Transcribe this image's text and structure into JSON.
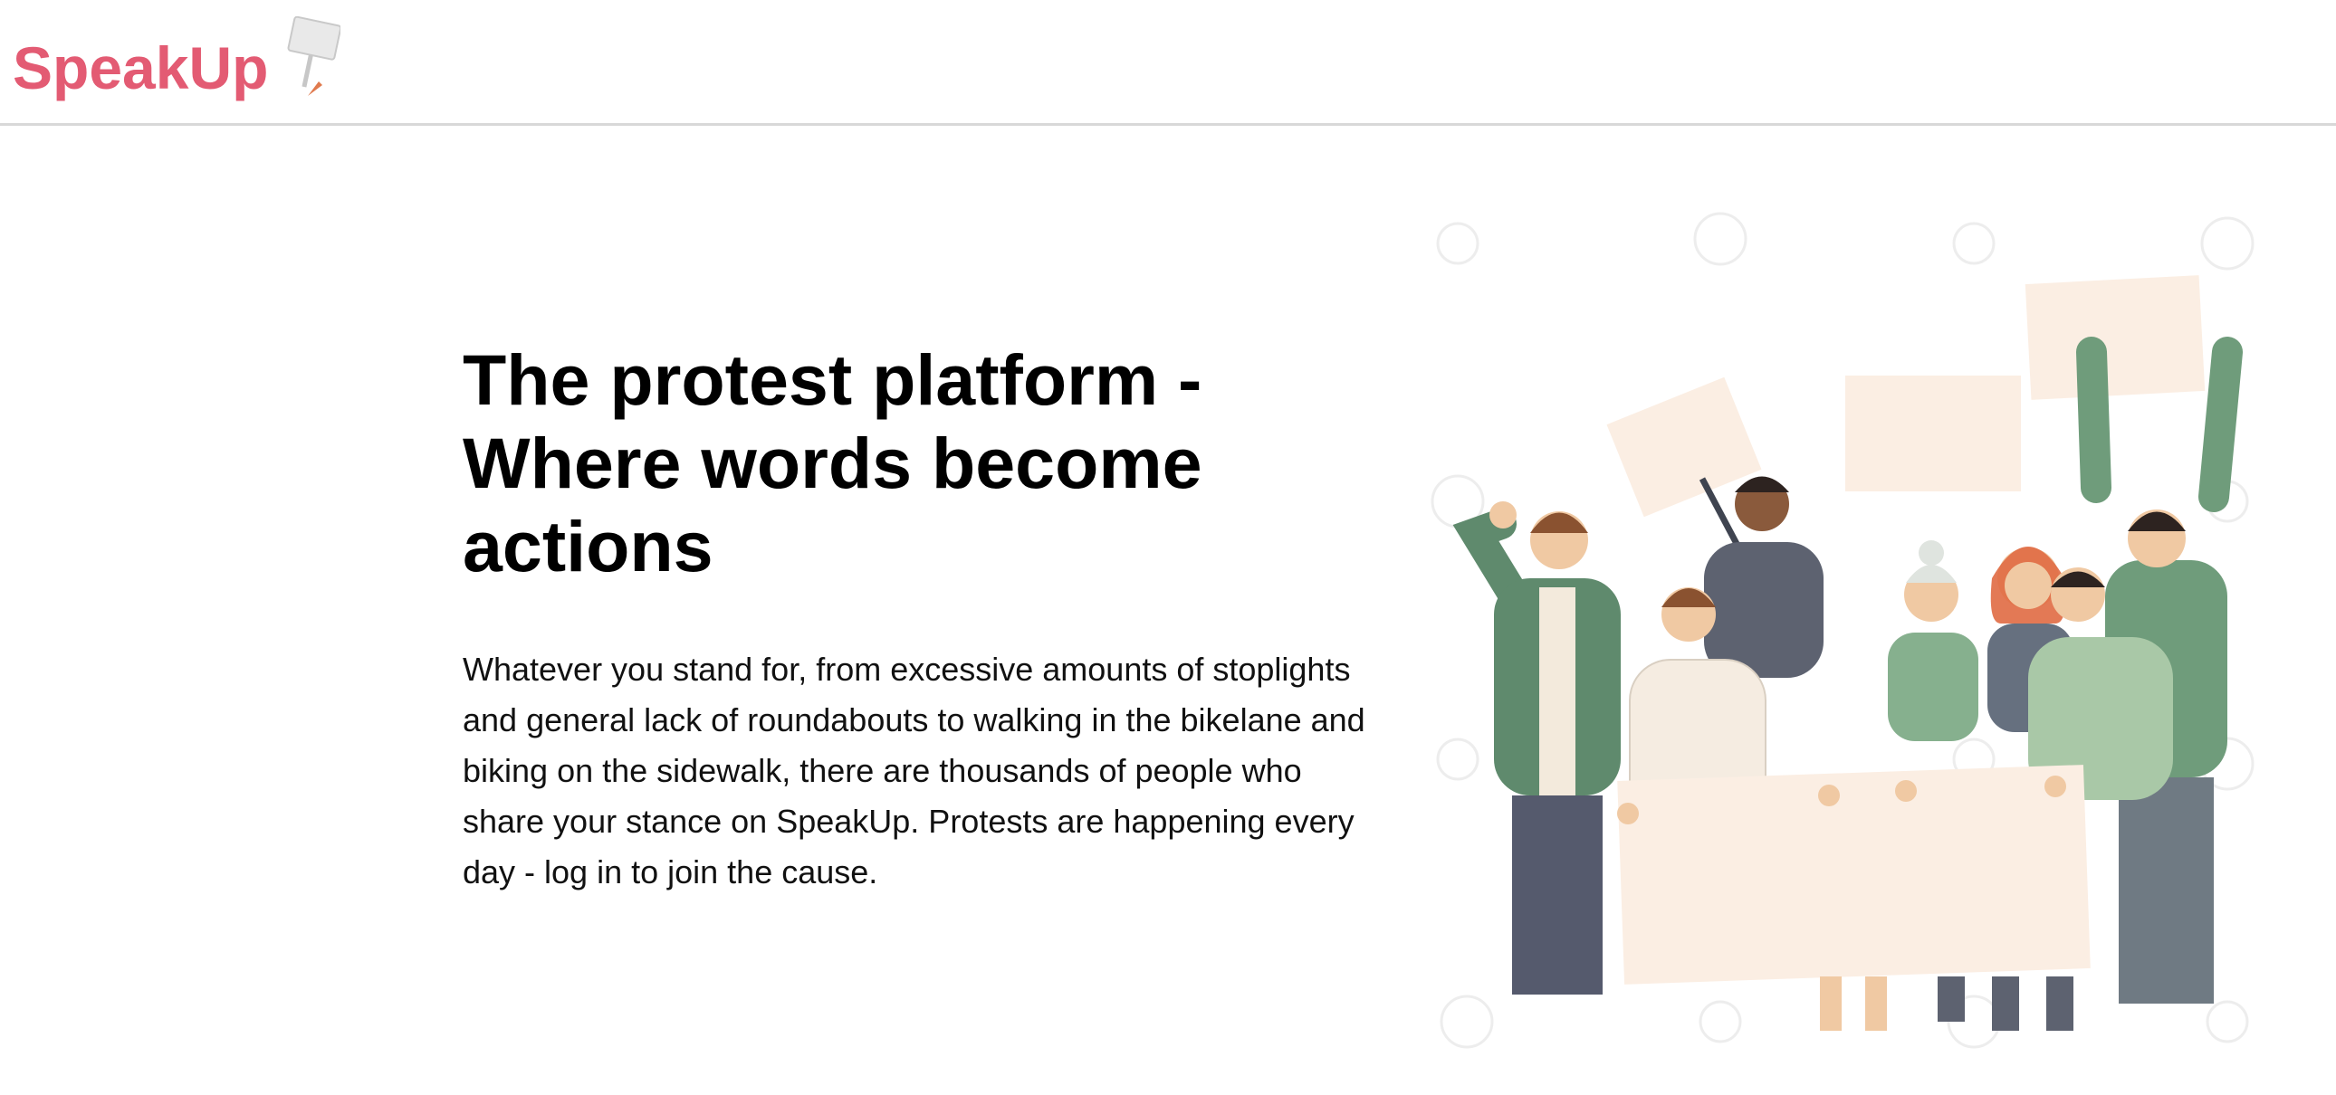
{
  "app": {
    "logo_text": "SpeakUp",
    "brand_color": "#e35b73"
  },
  "hero": {
    "headline": "The protest platform - Where words become actions",
    "body": "Whatever you stand for, from excessive amounts of stoplights and general lack of roundabouts to walking in the bikelane and biking on the sidewalk, there are thousands of people who share your stance on SpeakUp. Protests are happening every day - log in to join the cause.",
    "illustration": "protest-crowd-illustration"
  },
  "icons": {
    "logo_sign": "protest-sign-icon"
  }
}
